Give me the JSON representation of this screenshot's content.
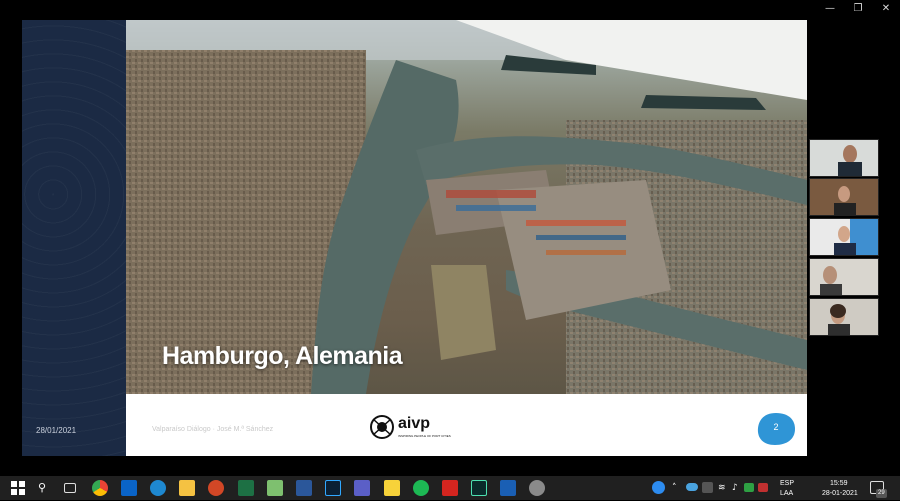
{
  "window_controls": {
    "minimize": "—",
    "maximize": "❐",
    "close": "✕"
  },
  "slide": {
    "date": "28/01/2021",
    "title": "Hamburgo, Alemania",
    "footer_text": "Valparaíso Diálogo · José M.ª Sánchez",
    "logo_text": "aivp",
    "logo_tagline": "INSPIRING PEOPLE OF PORT CITIES",
    "page_number": "2"
  },
  "participants": [
    "Participant 1",
    "Participant 2",
    "Participant 3",
    "Participant 4",
    "Participant 5"
  ],
  "taskbar": {
    "apps": [
      {
        "name": "start-icon"
      },
      {
        "name": "search-icon"
      },
      {
        "name": "task-view-icon"
      },
      {
        "name": "chrome-icon"
      },
      {
        "name": "outlook-icon"
      },
      {
        "name": "edge-icon"
      },
      {
        "name": "file-explorer-icon"
      },
      {
        "name": "powerpoint-icon"
      },
      {
        "name": "excel-icon"
      },
      {
        "name": "maps-icon"
      },
      {
        "name": "word-icon"
      },
      {
        "name": "photoshop-icon"
      },
      {
        "name": "teams-icon"
      },
      {
        "name": "sticky-notes-icon"
      },
      {
        "name": "spotify-icon"
      },
      {
        "name": "acrobat-icon"
      },
      {
        "name": "audition-icon"
      },
      {
        "name": "media-player-icon"
      },
      {
        "name": "snipping-tool-icon"
      }
    ],
    "tray": {
      "language": "ESP",
      "layout": "LAA",
      "time": "15:59",
      "date": "28-01-2021",
      "notification_count": "29"
    }
  }
}
